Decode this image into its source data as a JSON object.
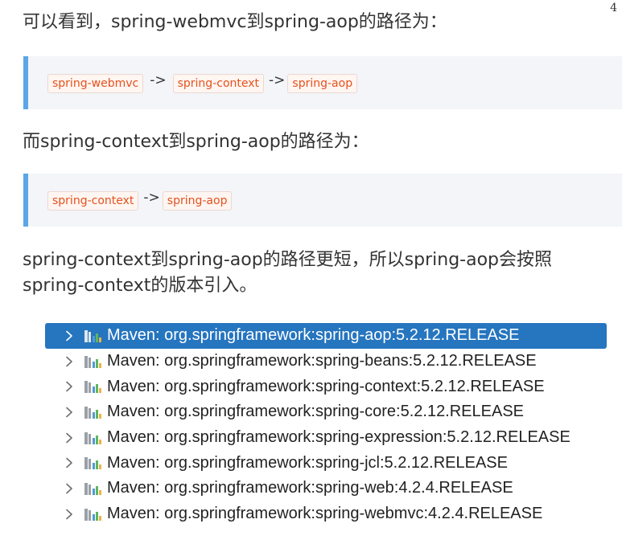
{
  "page_number": "4",
  "paragraphs": {
    "p1": "可以看到，spring-webmvc到spring-aop的路径为：",
    "p2": "而spring-context到spring-aop的路径为：",
    "p3_line1": "spring-context到spring-aop的路径更短，所以spring-aop会按照",
    "p3_line2": "spring-context的版本引入。"
  },
  "quote1": {
    "chip1": "spring-webmvc",
    "arrow1": "->",
    "chip2": "spring-context",
    "arrow2": "->",
    "chip3": "spring-aop"
  },
  "quote2": {
    "chip1": "spring-context",
    "arrow1": "->",
    "chip2": "spring-aop"
  },
  "libraries": [
    {
      "label": "Maven: org.springframework:spring-aop:5.2.12.RELEASE",
      "selected": true
    },
    {
      "label": "Maven: org.springframework:spring-beans:5.2.12.RELEASE",
      "selected": false
    },
    {
      "label": "Maven: org.springframework:spring-context:5.2.12.RELEASE",
      "selected": false
    },
    {
      "label": "Maven: org.springframework:spring-core:5.2.12.RELEASE",
      "selected": false
    },
    {
      "label": "Maven: org.springframework:spring-expression:5.2.12.RELEASE",
      "selected": false
    },
    {
      "label": "Maven: org.springframework:spring-jcl:5.2.12.RELEASE",
      "selected": false
    },
    {
      "label": "Maven: org.springframework:spring-web:4.2.4.RELEASE",
      "selected": false
    },
    {
      "label": "Maven: org.springframework:spring-webmvc:4.2.4.RELEASE",
      "selected": false
    }
  ],
  "icons": {
    "expand": "chevron-right-icon",
    "library": "maven-library-icon"
  },
  "colors": {
    "text": "#333333",
    "quote_border": "#5ba6e7",
    "quote_background": "#f3f5f8",
    "code_text": "#e4521e",
    "code_background": "#fff5f1",
    "selection": "#2675bf",
    "icon_bars": [
      "#4e9bd6",
      "#5fb55f",
      "#e6b54a"
    ]
  }
}
